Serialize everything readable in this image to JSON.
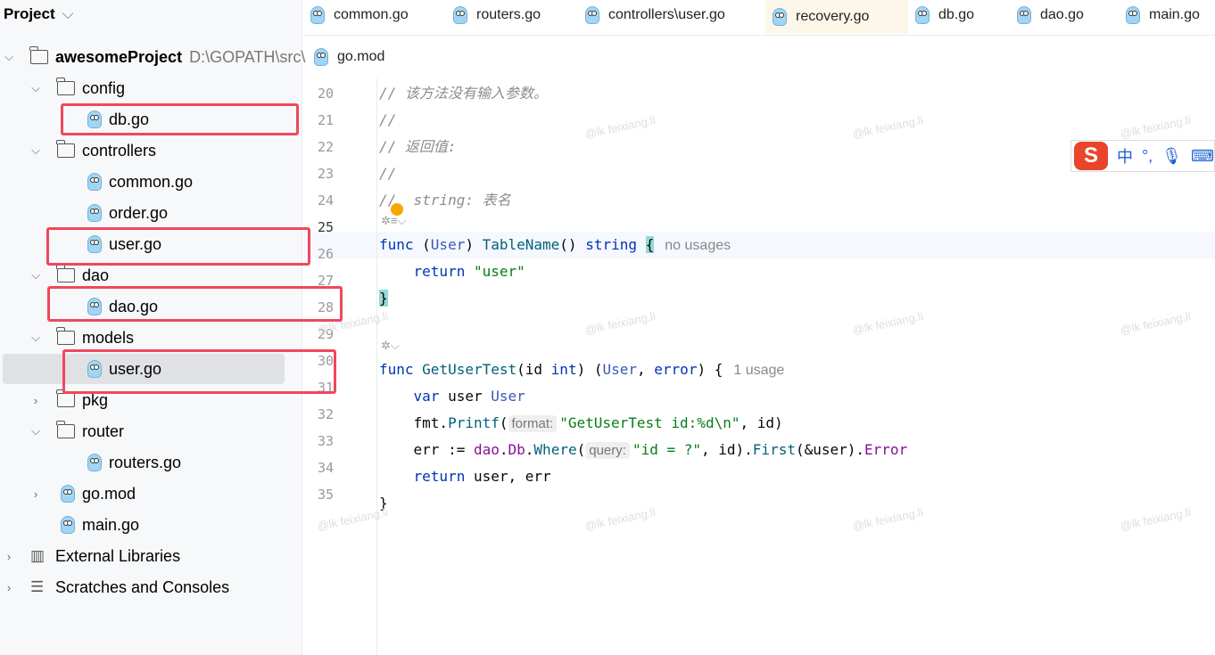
{
  "sidebar": {
    "title": "Project",
    "items": [
      {
        "label": "awesomeProject",
        "path": "D:\\GOPATH\\src\\",
        "type": "folder",
        "depth": 0,
        "expanded": true
      },
      {
        "label": "config",
        "type": "folder",
        "depth": 1,
        "expanded": true
      },
      {
        "label": "db.go",
        "type": "go",
        "depth": 2,
        "highlighted": true
      },
      {
        "label": "controllers",
        "type": "folder",
        "depth": 1,
        "expanded": true
      },
      {
        "label": "common.go",
        "type": "go",
        "depth": 2
      },
      {
        "label": "order.go",
        "type": "go",
        "depth": 2
      },
      {
        "label": "user.go",
        "type": "go",
        "depth": 2,
        "highlighted": true
      },
      {
        "label": "dao",
        "type": "folder",
        "depth": 1,
        "expanded": true
      },
      {
        "label": "dao.go",
        "type": "go",
        "depth": 2,
        "highlighted": true
      },
      {
        "label": "models",
        "type": "folder",
        "depth": 1,
        "expanded": true
      },
      {
        "label": "user.go",
        "type": "go",
        "depth": 2,
        "selected": true,
        "highlighted": true
      },
      {
        "label": "pkg",
        "type": "folder",
        "depth": 1,
        "expanded": false
      },
      {
        "label": "router",
        "type": "folder",
        "depth": 1,
        "expanded": true
      },
      {
        "label": "routers.go",
        "type": "go",
        "depth": 2
      },
      {
        "label": "go.mod",
        "type": "gomod",
        "depth": 1,
        "expanded": false
      },
      {
        "label": "main.go",
        "type": "go",
        "depth": 1
      },
      {
        "label": "External Libraries",
        "type": "libs",
        "depth": 0,
        "expanded": false
      },
      {
        "label": "Scratches and Consoles",
        "type": "scratch",
        "depth": 0,
        "expanded": false
      }
    ]
  },
  "tabs": [
    "common.go",
    "routers.go",
    "controllers\\user.go",
    "recovery.go",
    "db.go",
    "dao.go",
    "main.go"
  ],
  "active_tab": "recovery.go",
  "tabs_row2": [
    "go.mod"
  ],
  "editor": {
    "line_numbers": [
      "20",
      "21",
      "22",
      "23",
      "24",
      "25",
      "26",
      "27",
      "28",
      "29",
      "30",
      "31",
      "32",
      "33",
      "34",
      "35"
    ],
    "current_line": "25",
    "lines": {
      "l20": "// 该方法没有输入参数。",
      "l21": "//",
      "l22": "// 返回值:",
      "l23": "//",
      "l24": "//  string: 表名",
      "l25_hint": "no usages",
      "l26_str": "\"user\"",
      "l29_hint": "1 usage",
      "l31_inlay": "format:",
      "l31_str": "\"GetUserTest id:%d\\n\"",
      "l32_inlay": "query:",
      "l32_str": "\"id = ?\""
    }
  },
  "watermark": "@lk feixiang.li",
  "ime": {
    "logo": "S",
    "mode": "中",
    "punct": "°,",
    "mic": "mic-icon",
    "keyboard": "keyboard-icon"
  },
  "colors": {
    "highlight_box": "#f0475c",
    "keyword": "#0033b3",
    "string": "#067d17",
    "active_tab_bg": "#fdf7ea"
  }
}
